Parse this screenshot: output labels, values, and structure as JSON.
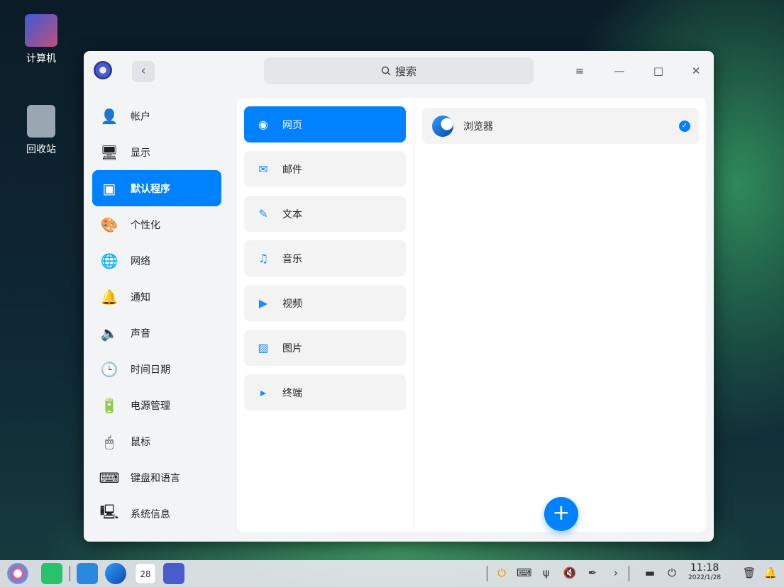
{
  "desktop": {
    "icons": [
      {
        "label": "计算机"
      },
      {
        "label": "回收站"
      }
    ]
  },
  "window": {
    "back_glyph": "‹",
    "search_placeholder": "搜索",
    "controls": {
      "menu": "≡",
      "minimize": "—",
      "maximize": "□",
      "close": "✕"
    }
  },
  "sidebar": {
    "items": [
      {
        "label": "帐户",
        "icon": "account-icon"
      },
      {
        "label": "显示",
        "icon": "display-icon"
      },
      {
        "label": "默认程序",
        "icon": "default-apps-icon",
        "active": true
      },
      {
        "label": "个性化",
        "icon": "personalization-icon"
      },
      {
        "label": "网络",
        "icon": "network-icon"
      },
      {
        "label": "通知",
        "icon": "notification-icon"
      },
      {
        "label": "声音",
        "icon": "sound-icon"
      },
      {
        "label": "时间日期",
        "icon": "clock-icon"
      },
      {
        "label": "电源管理",
        "icon": "battery-icon"
      },
      {
        "label": "鼠标",
        "icon": "mouse-icon"
      },
      {
        "label": "键盘和语言",
        "icon": "keyboard-icon"
      },
      {
        "label": "系统信息",
        "icon": "system-info-icon"
      }
    ]
  },
  "categories": [
    {
      "label": "网页",
      "icon": "web-icon",
      "active": true
    },
    {
      "label": "邮件",
      "icon": "mail-icon"
    },
    {
      "label": "文本",
      "icon": "text-icon"
    },
    {
      "label": "音乐",
      "icon": "music-icon"
    },
    {
      "label": "视频",
      "icon": "video-icon"
    },
    {
      "label": "图片",
      "icon": "picture-icon"
    },
    {
      "label": "终端",
      "icon": "terminal-icon"
    }
  ],
  "apps": [
    {
      "label": "浏览器",
      "icon": "browser-icon",
      "selected": true
    }
  ],
  "add_button_glyph": "+",
  "taskbar": {
    "time": "11:18",
    "date": "2022/1/28",
    "calendar_day": "28"
  },
  "colors": {
    "accent": "#0081ff"
  }
}
